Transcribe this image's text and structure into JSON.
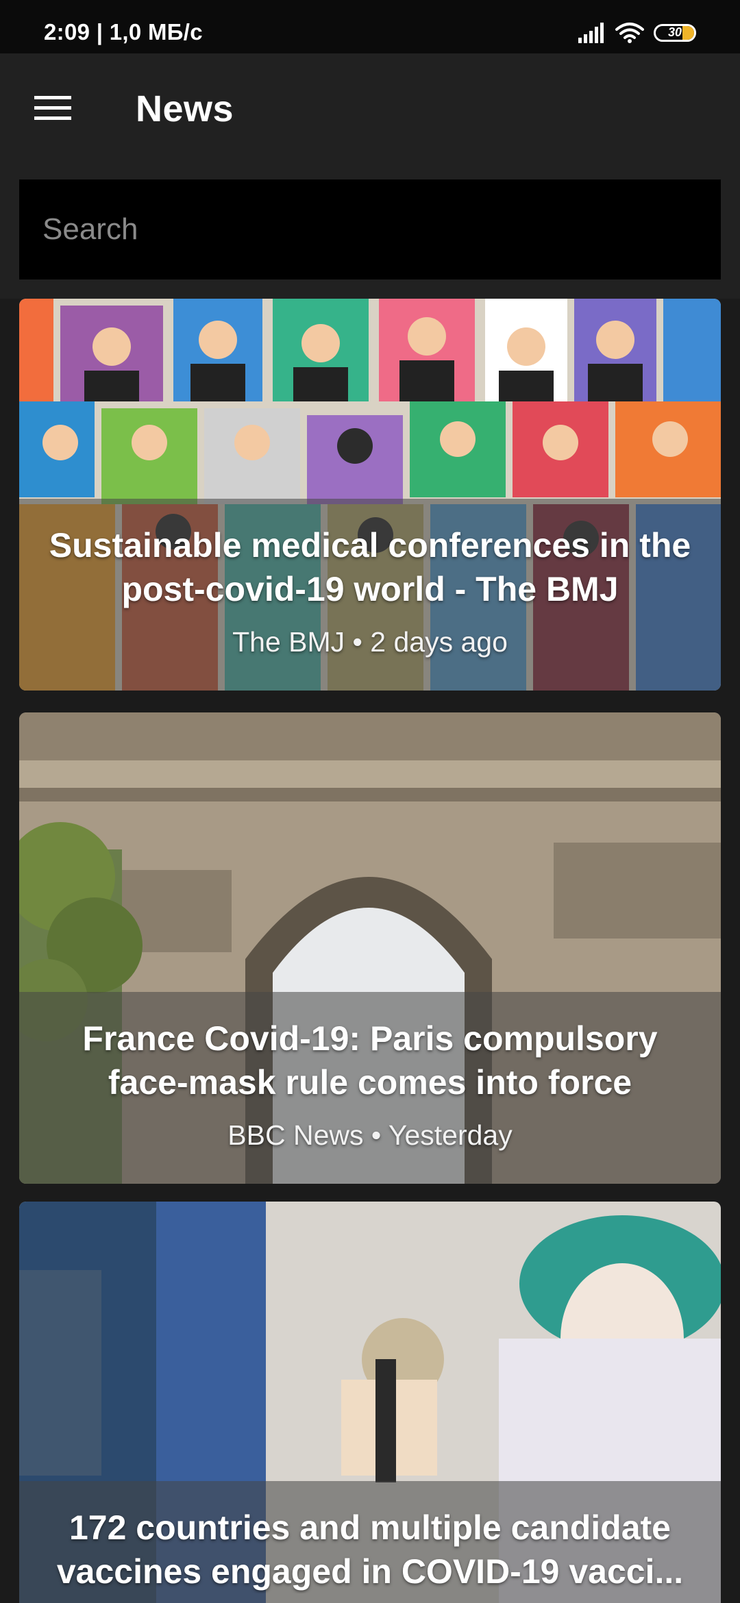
{
  "status_bar": {
    "time": "2:09 | 1,0 МБ/с",
    "battery": "30",
    "icons": [
      "signal-icon",
      "wifi-icon",
      "battery-icon"
    ]
  },
  "app_bar": {
    "title": "News",
    "menu_icon": "hamburger-menu-icon"
  },
  "search": {
    "placeholder": "Search",
    "value": ""
  },
  "articles": [
    {
      "title": "Sustainable medical conferences in the post-covid-19 world - The BMJ",
      "meta": "The BMJ • 2 days ago"
    },
    {
      "title": "France Covid-19: Paris compulsory face-mask rule comes into force",
      "meta": "BBC News • Yesterday"
    },
    {
      "title": "172 countries and multiple candidate vaccines engaged in COVID-19 vacci...",
      "meta": ""
    }
  ],
  "colors": {
    "background": "#1b1b1b",
    "app_bar": "#212121",
    "status_bar": "#0b0b0b",
    "search_bg": "#000000",
    "battery_fill": "#f0b429"
  }
}
